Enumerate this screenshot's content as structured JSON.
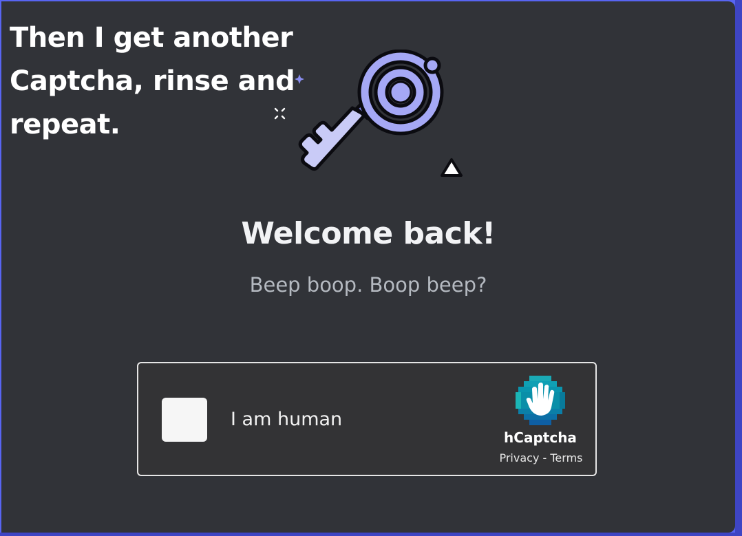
{
  "caption": {
    "line1": "Then I get another",
    "line2": "Captcha, rinse and",
    "line3": "repeat."
  },
  "login": {
    "title": "Welcome back!",
    "subtitle": "Beep boop. Boop beep?"
  },
  "captcha": {
    "checkbox_label": "I am human",
    "provider": "hCaptcha",
    "privacy_link": "Privacy",
    "separator": " - ",
    "terms_link": "Terms",
    "checked": false
  },
  "colors": {
    "panel_bg": "#313338",
    "accent": "#5865f2",
    "key_fill": "#a5a8f5",
    "hcaptcha_teal": "#0a8fa8"
  },
  "icons": {
    "illustration": "key-icon",
    "sparkle": "sparkle-icon",
    "warning": "triangle-icon",
    "hcaptcha": "hcaptcha-hand-logo-icon"
  }
}
